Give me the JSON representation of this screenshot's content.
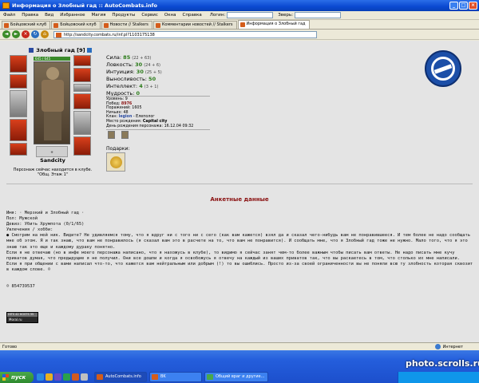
{
  "window": {
    "title": "Информация о Злобный гад :: AutoCombats.info"
  },
  "menu": {
    "items": [
      "Файл",
      "Правка",
      "Вид",
      "Избранное",
      "Магия",
      "Продукты",
      "Сервис",
      "Окна",
      "Справка"
    ],
    "login_label": "Логин:",
    "zver_label": "Зверь:"
  },
  "tabs": [
    {
      "label": "Бойцовский клуб"
    },
    {
      "label": "Бойцовский клуб"
    },
    {
      "label": "Новости // Stalkers"
    },
    {
      "label": "Комментарии новостей // Stalkers"
    },
    {
      "label": "Информация о Злобный гад"
    }
  ],
  "address": {
    "url": "http://sandcity.combats.ru/inf.pl?1103175138"
  },
  "character": {
    "name": "Злобный гад",
    "level": "[9]",
    "hp": "645 / 645",
    "club": "Sandcity",
    "location_line1": "Персонаж сейчас находится в клубе.",
    "location_line2": "\"Общ. Этаж 1\""
  },
  "stats": [
    {
      "label": "Сила:",
      "value": "85",
      "bonus": "(22 + 63)"
    },
    {
      "label": "Ловкость:",
      "value": "30",
      "bonus": "(24 + 6)"
    },
    {
      "label": "Интуиция:",
      "value": "30",
      "bonus": "(25 + 5)"
    },
    {
      "label": "Выносливость:",
      "value": "50",
      "bonus": ""
    },
    {
      "label": "Интеллект:",
      "value": "4",
      "bonus": "(3 + 1)"
    },
    {
      "label": "Мудрость:",
      "value": "0",
      "bonus": ""
    }
  ],
  "info": {
    "level": "Уровень: 9",
    "wins_label": "Побед:",
    "wins": "8976",
    "losses": "Поражений: 1605",
    "draws": "Ничьих: 48",
    "clan_label": "Клан:",
    "clan": "legion",
    "clan_rank": " - Елеполог",
    "birthplace_label": "Место рождения:",
    "birthplace": "Capital city",
    "birthday": "День рождения персонажа: 16.12.04 09:32"
  },
  "gifts_label": "Подарки:",
  "colors": {
    "accent_red": "#8a1010",
    "stat_green": "#2a7a18",
    "xp_blue": "#0a49d1"
  },
  "anketa": {
    "title": "Анкетные данные",
    "name_line": "Имя: · Мерзкий и Злобный гад ·",
    "gender_line": "Пол: Мужской",
    "motto_line": "Девиз: Убить Хрумпота (0/1/65)",
    "hobbies_label": "Увлечения / хобби:",
    "para1": "● Смотрим на мой ник. Видите? Не удивляемся тому, что я вдруг ни с того ни с сего (как вам кажется) взял да и сказал чего-нибудь вам не понравившееся. И тем более не надо сообщать мне об этом. Я и так знаю, что вам не понравилось (я сказал вам это в расчете на то, что вам не понравится). И сообщать мне, что я Злобный гад тоже не нужно. Мало того, что я это знаю так это еще и каждому дураку понятно.",
    "para2": "Если я не отвечаю (но в инфе моего персонажа написано, что я нахожусь в клубе), то видимо я сейчас занят чем-то более важным чтобы писать вам ответы. Не надо писать мне кучу приватов думая, что предыдущие я не получил. Они все дошли и когда я освобожусь я отвечу на каждый из ваших приватов так, что вы раскаетесь в том, что столько их мне написали.",
    "para3": "Если я при общении с вами написал что-то, что кажется вам нейтральным или добрым (!) то вы ошиблись. Просто из-за своей ограниченности вы не поняли всю ту злобность которая сквозит в каждом слове. ☺",
    "icq": "☺ 854739537"
  },
  "counter": {
    "top": "HITS 42 HOSTS 35",
    "bottom": "Moral.ru"
  },
  "status": {
    "left": "Готово",
    "zone": "Интернет"
  },
  "taskbar": {
    "start": "пуск",
    "tasks": [
      {
        "label": "AutoCombats.info"
      },
      {
        "label": "BK"
      },
      {
        "label": "Общий враг и другие..."
      }
    ]
  },
  "watermark": "photo.scrolls.ru"
}
